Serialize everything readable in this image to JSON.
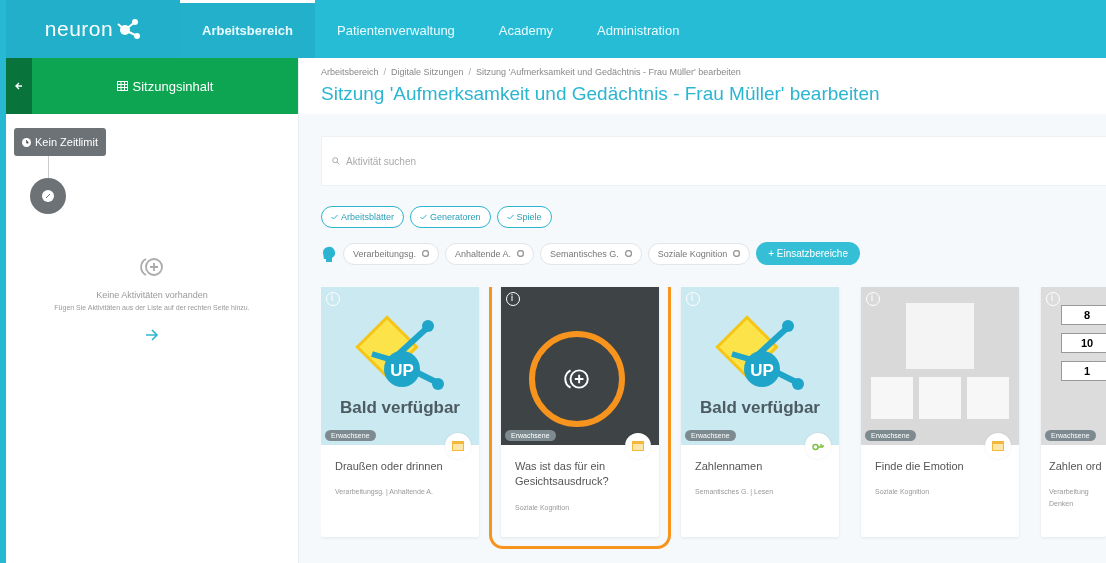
{
  "nav": {
    "logo": "neuron",
    "tabs": [
      {
        "label": "Arbeitsbereich",
        "selected": true
      },
      {
        "label": "Patientenverwaltung",
        "selected": false
      },
      {
        "label": "Academy",
        "selected": false
      },
      {
        "label": "Administration",
        "selected": false
      }
    ]
  },
  "sidebar": {
    "title": "Sitzungsinhalt",
    "time_limit": "Kein Zeitlimit",
    "empty_title": "Keine Aktivitäten vorhanden",
    "empty_hint": "Fügen Sie Aktivitäten aus der Liste auf der rechten Seite hinzu."
  },
  "breadcrumb_separator": "/",
  "breadcrumb": [
    "Arbeitsbereich",
    "Digitale Sitzungen",
    "Sitzung 'Aufmerksamkeit und Gedächtnis - Frau Müller' bearbeiten"
  ],
  "page_title": "Sitzung 'Aufmerksamkeit und Gedächtnis - Frau Müller' bearbeiten",
  "search": {
    "placeholder": "Aktivität suchen"
  },
  "filters": [
    {
      "label": "Arbeitsblätter",
      "checked": true
    },
    {
      "label": "Generatoren",
      "checked": true
    },
    {
      "label": "Spiele",
      "checked": true
    }
  ],
  "areas": [
    "Verarbeitungsg.",
    "Anhaltende A.",
    "Semantisches G.",
    "Soziale Kognition"
  ],
  "add_area": "+ Einsatzbereiche",
  "cards": [
    {
      "kind": "coming_soon",
      "caption": "Bald verfügbar",
      "logo_text": "UP",
      "badge": "Erwachsene",
      "generator": false,
      "title": "Draußen oder drinnen",
      "meta": "Verarbeitungsg. | Anhaltende A.",
      "selected": false
    },
    {
      "kind": "photo",
      "badge": "Erwachsene",
      "generator": false,
      "title": "Was ist das für ein Gesichtsausdruck?",
      "meta": "Soziale Kognition",
      "selected": true
    },
    {
      "kind": "coming_soon",
      "caption": "Bald verfügbar",
      "logo_text": "UP",
      "badge": "Erwachsene",
      "generator": true,
      "title": "Zahlennamen",
      "meta": "Semantisches G. | Lesen",
      "selected": false
    },
    {
      "kind": "faces",
      "badge": "Erwachsene",
      "generator": false,
      "title": "Finde die Emotion",
      "meta": "Soziale Kognition",
      "selected": false
    },
    {
      "kind": "numbers",
      "numbers": [
        "8",
        "10",
        "1"
      ],
      "badge": "Erwachsene",
      "title": "Zahlen ord",
      "meta": "Verarbeitung Denken",
      "selected": false
    }
  ]
}
